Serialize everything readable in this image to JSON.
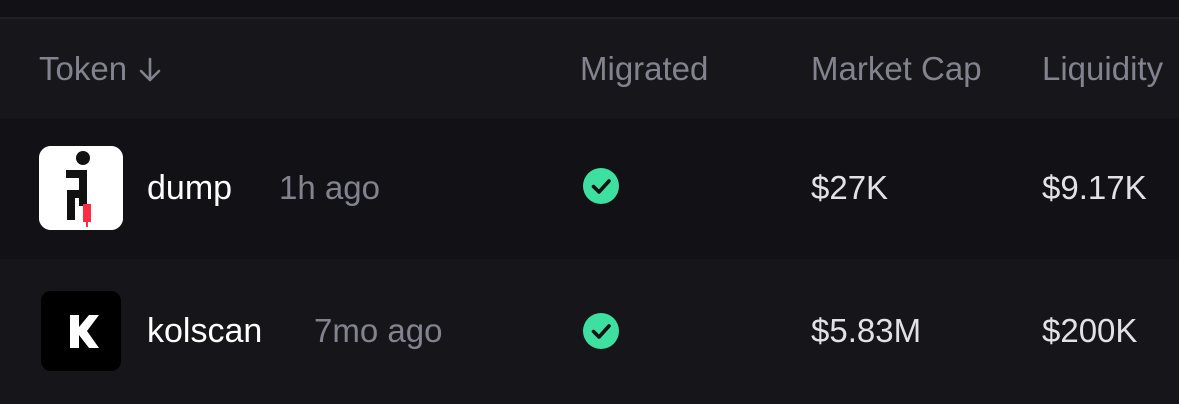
{
  "table": {
    "headers": {
      "token": "Token",
      "migrated": "Migrated",
      "market_cap": "Market Cap",
      "liquidity": "Liquidity"
    },
    "sort_icon": "arrow-down-icon",
    "rows": [
      {
        "name": "dump",
        "age": "1h ago",
        "migrated_icon": "check-circle-icon",
        "market_cap": "$27K",
        "liquidity": "$9.17K"
      },
      {
        "name": "kolscan",
        "age": "7mo ago",
        "migrated_icon": "check-circle-icon",
        "market_cap": "$5.83M",
        "liquidity": "$200K"
      }
    ]
  },
  "colors": {
    "background": "#121216",
    "header_background": "#17171b",
    "muted_text": "#83838f",
    "check_green": "#3ee0a0"
  }
}
